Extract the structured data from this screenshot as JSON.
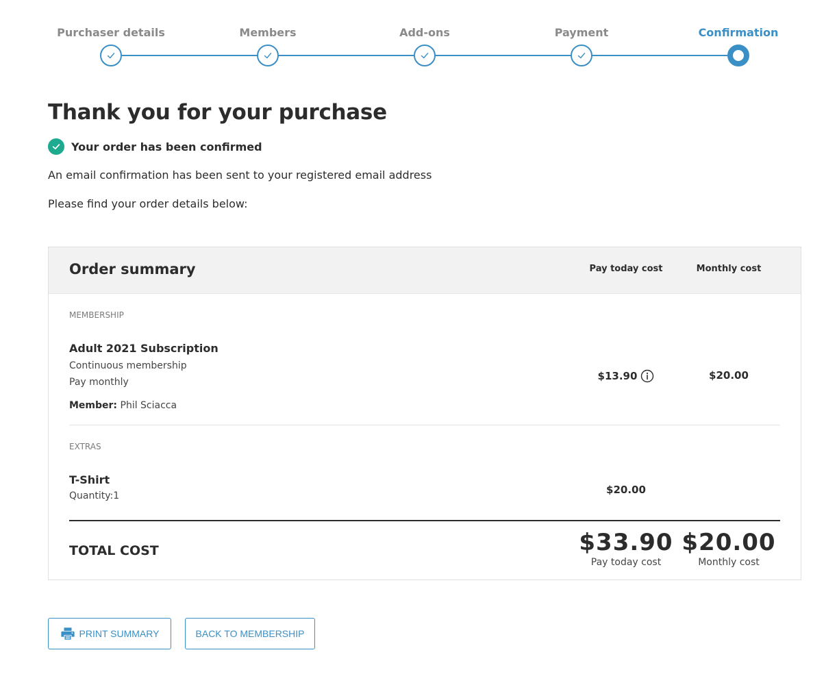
{
  "stepper": {
    "steps": [
      {
        "label": "Purchaser details",
        "state": "complete"
      },
      {
        "label": "Members",
        "state": "complete"
      },
      {
        "label": "Add-ons",
        "state": "complete"
      },
      {
        "label": "Payment",
        "state": "complete"
      },
      {
        "label": "Confirmation",
        "state": "current"
      }
    ]
  },
  "heading": {
    "title": "Thank you for your purchase",
    "confirmed": "Your order has been confirmed",
    "email_note": "An email confirmation has been sent to your registered email address",
    "details_note": "Please find your order details below:"
  },
  "summary": {
    "title": "Order summary",
    "col_pay_today": "Pay today cost",
    "col_monthly": "Monthly cost",
    "membership": {
      "section": "MEMBERSHIP",
      "name": "Adult 2021 Subscription",
      "line1": "Continuous membership",
      "line2": "Pay monthly",
      "member_label": "Member:",
      "member_name": "Phil Sciacca",
      "pay_today": "$13.90",
      "monthly": "$20.00"
    },
    "extras": {
      "section": "EXTRAS",
      "name": "T-Shirt",
      "quantity": "Quantity:1",
      "pay_today": "$20.00"
    },
    "total": {
      "label": "TOTAL COST",
      "pay_today": "$33.90",
      "pay_today_caption": "Pay today cost",
      "monthly": "$20.00",
      "monthly_caption": "Monthly cost"
    }
  },
  "buttons": {
    "print": "PRINT SUMMARY",
    "back": "BACK TO MEMBERSHIP"
  },
  "colors": {
    "accent": "#3a8fc6",
    "success": "#1eaa8f",
    "header_bg": "#f2f2f2"
  }
}
